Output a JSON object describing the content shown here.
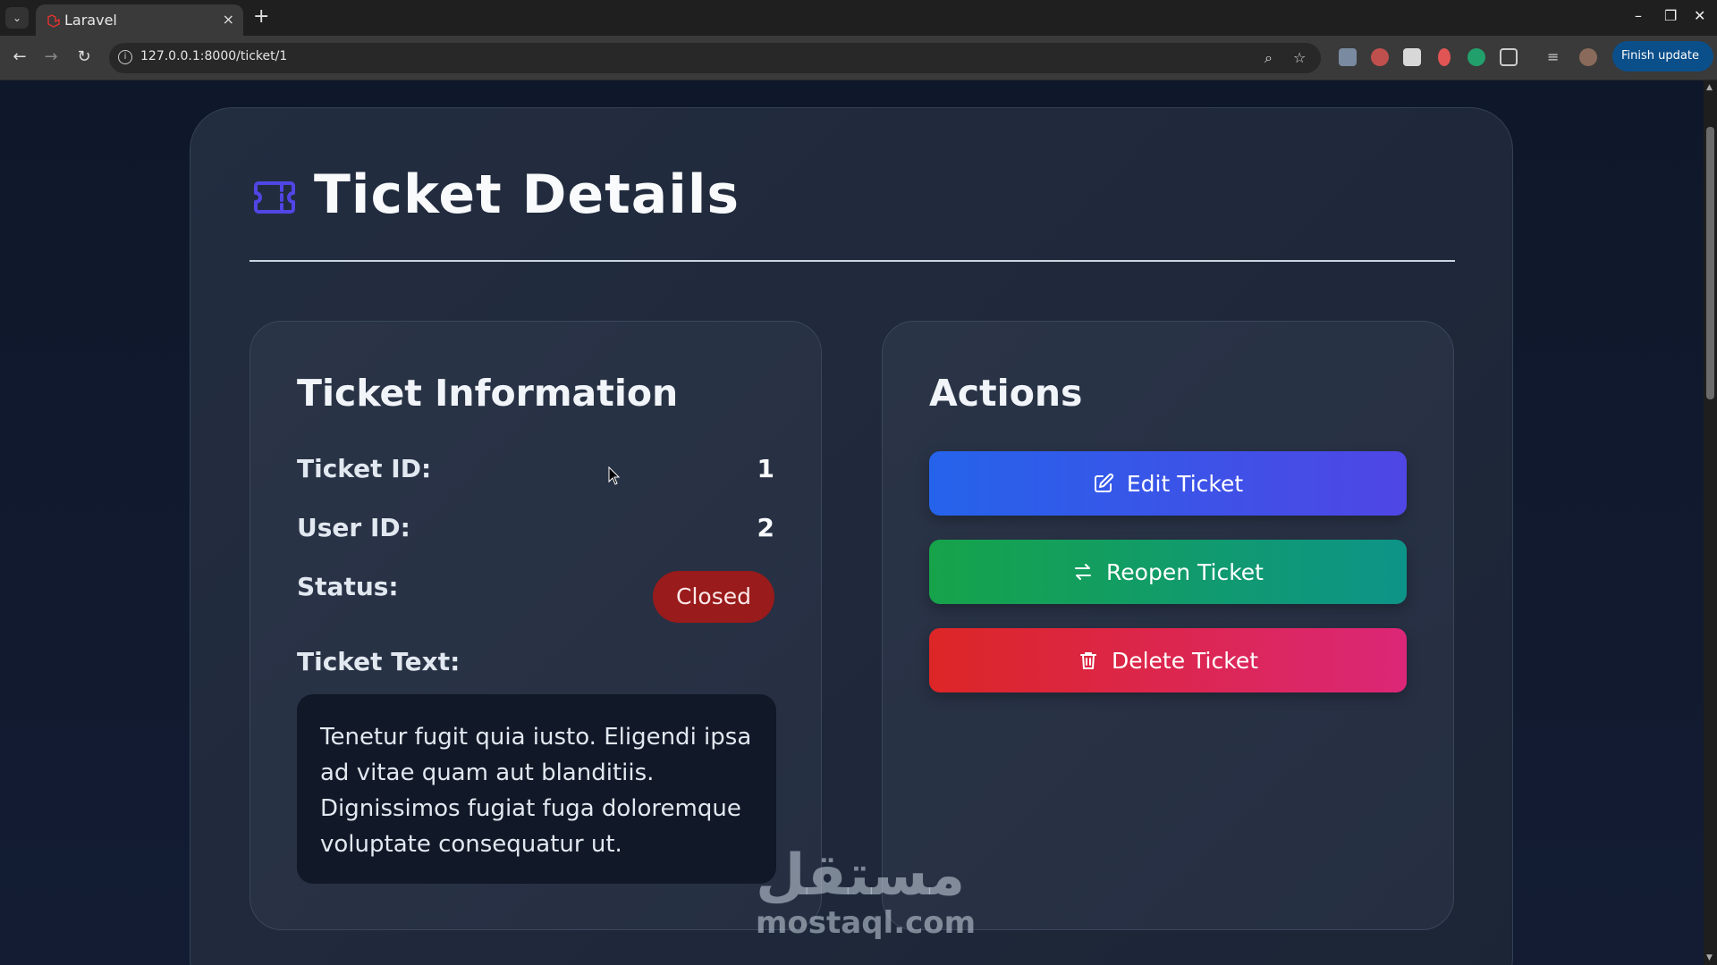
{
  "browser": {
    "tab_title": "Laravel",
    "tab_close": "×",
    "new_tab": "+",
    "url": "127.0.0.1:8000/ticket/1",
    "finish_update": "Finish update",
    "win_minimize": "–",
    "win_restore": "❐",
    "win_close": "✕"
  },
  "page": {
    "title": "Ticket Details"
  },
  "info": {
    "heading": "Ticket Information",
    "ticket_id_label": "Ticket ID:",
    "ticket_id_value": "1",
    "user_id_label": "User ID:",
    "user_id_value": "2",
    "status_label": "Status:",
    "status_value": "Closed",
    "text_label": "Ticket Text:",
    "text_value": "Tenetur fugit quia iusto. Eligendi ipsa ad vitae quam aut blanditiis. Dignissimos fugiat fuga doloremque voluptate consequatur ut."
  },
  "actions": {
    "heading": "Actions",
    "edit_label": "Edit Ticket",
    "reopen_label": "Reopen Ticket",
    "delete_label": "Delete Ticket"
  },
  "watermark": {
    "arabic": "مستقل",
    "latin": "mostaql.com"
  },
  "colors": {
    "page_bg": "#0f172a",
    "card_bg": "#1e293b",
    "status_closed": "#991b1b",
    "edit_gradient": [
      "#2563eb",
      "#4f46e5"
    ],
    "reopen_gradient": [
      "#16a34a",
      "#0d9488"
    ],
    "delete_gradient": [
      "#dc2626",
      "#db2777"
    ]
  },
  "icons": {
    "header": "ticket-icon",
    "edit": "pencil-square-icon",
    "reopen": "arrows-exchange-icon",
    "delete": "trash-icon"
  }
}
